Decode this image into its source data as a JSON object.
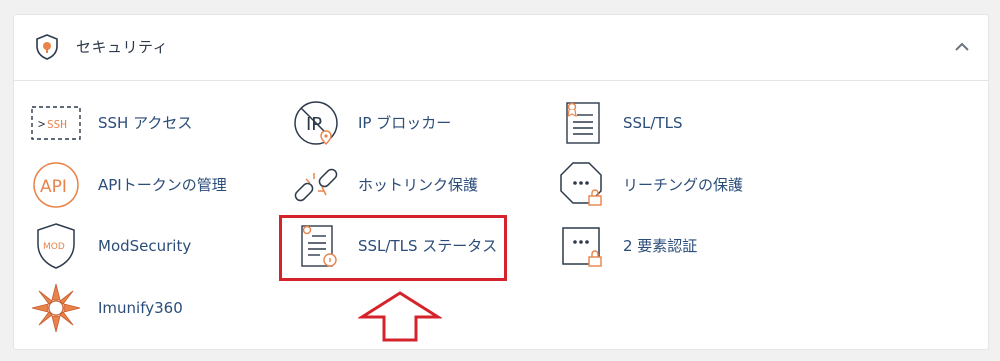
{
  "section": {
    "title": "セキュリティ",
    "title_icon": "shield-icon",
    "collapse_icon": "chevron-up-icon"
  },
  "items": [
    {
      "label": "SSH アクセス",
      "icon": "ssh-terminal-icon"
    },
    {
      "label": "IP ブロッカー",
      "icon": "ip-blocker-icon"
    },
    {
      "label": "SSL/TLS",
      "icon": "ssl-certificate-icon"
    },
    {
      "label": "APIトークンの管理",
      "icon": "api-icon"
    },
    {
      "label": "ホットリンク保護",
      "icon": "broken-link-icon"
    },
    {
      "label": "リーチングの保護",
      "icon": "leech-protect-icon"
    },
    {
      "label": "ModSecurity",
      "icon": "modsecurity-shield-icon"
    },
    {
      "label": "SSL/TLS ステータス",
      "icon": "ssl-status-icon"
    },
    {
      "label": "2 要素認証",
      "icon": "two-factor-auth-icon"
    },
    {
      "label": "Imunify360",
      "icon": "imunify360-logo-icon"
    }
  ],
  "annotation": {
    "highlight_color": "#d4232b",
    "highlighted_item": "SSL/TLS ステータス"
  },
  "colors": {
    "link": "#2b4d7a",
    "icon_dark": "#2d3a4a",
    "icon_accent": "#e8844a"
  }
}
